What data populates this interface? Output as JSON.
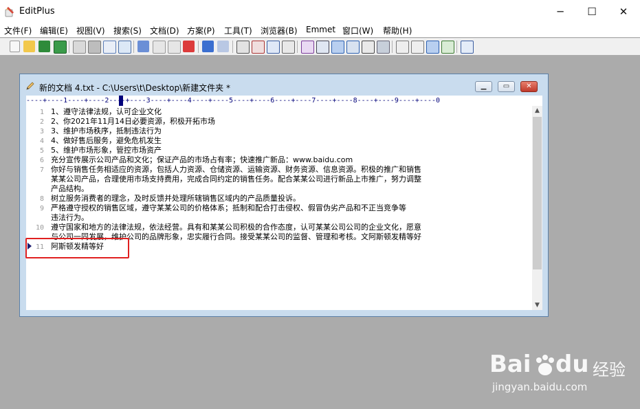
{
  "app": {
    "title": "EditPlus"
  },
  "window_controls": {
    "minimize": "─",
    "maximize": "☐",
    "close": "✕"
  },
  "menu": [
    {
      "label": "文件(F)"
    },
    {
      "label": "编辑(E)"
    },
    {
      "label": "视图(V)"
    },
    {
      "label": "搜索(S)"
    },
    {
      "label": "文档(D)"
    },
    {
      "label": "方案(P)"
    },
    {
      "label": "工具(T)"
    },
    {
      "label": "浏览器(B)"
    },
    {
      "label": "Emmet"
    },
    {
      "label": "窗口(W)"
    },
    {
      "label": "帮助(H)"
    }
  ],
  "toolbar": {
    "icons": [
      "new-file-icon",
      "open-folder-icon",
      "save-icon",
      "save-all-icon",
      "print-preview-icon",
      "print-icon",
      "spell-check-icon",
      "browser-icon",
      "cut-icon",
      "copy-icon",
      "paste-icon",
      "delete-icon",
      "undo-icon",
      "redo-icon",
      "find-icon",
      "replace-icon",
      "go-to-icon",
      "word-wrap-icon",
      "font-icon",
      "heading-icon",
      "word-wrap-toggle-icon",
      "line-number-icon",
      "abc-icon",
      "settings-icon",
      "cliptext-icon",
      "directory-icon",
      "document-selector-icon",
      "output-window-icon",
      "help-icon"
    ]
  },
  "document": {
    "title": "新的文档 4.txt - C:\\Users\\t\\Desktop\\新建文件夹 *",
    "ruler": "----+----1----+----2----+----3----+----4----+----5----+----6----+----7----+----8----+----9----+----0",
    "lines": [
      {
        "num": "1",
        "text": "1、遵守法律法规，认可企业文化"
      },
      {
        "num": "2",
        "text": "2、你2021年11月14日必要资源，积极开拓市场"
      },
      {
        "num": "3",
        "text": "3、维护市场秩序，抵制违法行为"
      },
      {
        "num": "4",
        "text": "4、做好售后服务，避免危机发生"
      },
      {
        "num": "5",
        "text": "5、维护市场形象，管控市场资产"
      },
      {
        "num": "6",
        "text": "充分宣传展示公司产品和文化；保证产品的市场占有率；快速推广新品：www.baidu.com"
      },
      {
        "num": "7",
        "text": "你好与销售任务相适应的资源，包括人力资源、仓储资源、运输资源、财务资源、信息资源。积极的推广和销售"
      },
      {
        "num": "",
        "text": "某某公司产品，合理使用市场支持费用，完成合同约定的销售任务。配合某某公司进行新品上市推广，努力调整"
      },
      {
        "num": "",
        "text": "产品结构。"
      },
      {
        "num": "8",
        "text": "树立服务消费者的理念，及时反馈并处理所辖销售区域内的产品质量投诉。"
      },
      {
        "num": "9",
        "text": "严格遵守授权的销售区域，遵守某某公司的价格体系；抵制和配合打击侵权、假冒伪劣产品和不正当竞争等"
      },
      {
        "num": "",
        "text": "违法行为。"
      },
      {
        "num": "10",
        "text": "遵守国家和地方的法律法规，依法经营。具有和某某公司积极的合作态度，认可某某公司公司的企业文化，愿意"
      },
      {
        "num": "",
        "text": "与公司一同发展，维护公司的品牌形象，忠实履行合同。接受某某公司的监督、管理和考核。文阿斯顿发精等好"
      },
      {
        "num": "11",
        "text": "阿斯顿发精等好"
      }
    ]
  },
  "watermark": {
    "brand": "Bai",
    "brand_suffix": "du",
    "cn": "经验",
    "url": "jingyan.baidu.com"
  },
  "colors": {
    "highlight_box": "#e02020",
    "line_number": "#999999",
    "ruler_text": "#00007a"
  }
}
